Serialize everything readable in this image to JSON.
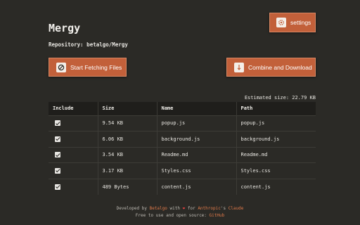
{
  "app": {
    "title": "Mergy",
    "repository_label": "Repository: betalgo/Mergy"
  },
  "buttons": {
    "settings": "settings",
    "start_fetching": "Start Fetching Files",
    "combine_download": "Combine and Download"
  },
  "estimated_size": "Estimated size: 22.79 KB",
  "table": {
    "headers": [
      "Include",
      "Size",
      "Name",
      "Path"
    ],
    "rows": [
      {
        "include": true,
        "size": "9.54 KB",
        "name": "popup.js",
        "path": "popup.js"
      },
      {
        "include": true,
        "size": "6.06 KB",
        "name": "background.js",
        "path": "background.js"
      },
      {
        "include": true,
        "size": "3.54 KB",
        "name": "Readme.md",
        "path": "Readme.md"
      },
      {
        "include": true,
        "size": "3.17 KB",
        "name": "Styles.css",
        "path": "Styles.css"
      },
      {
        "include": true,
        "size": "489 Bytes",
        "name": "content.js",
        "path": "content.js"
      }
    ]
  },
  "footer": {
    "developed_by": "Developed by",
    "author": "Betalgo",
    "with": "with",
    "heart": "❤",
    "for": "for",
    "company": "Anthropic",
    "possessive": "'s",
    "product": "Claude",
    "line2_text": "Free to use and open source:",
    "github": "GitHub"
  },
  "icons": {
    "settings": "gear-icon",
    "fetch": "fetch-icon",
    "combine": "download-icon"
  },
  "colors": {
    "background": "#2b2a26",
    "accent": "#c2603a",
    "link": "#e07a4a"
  }
}
